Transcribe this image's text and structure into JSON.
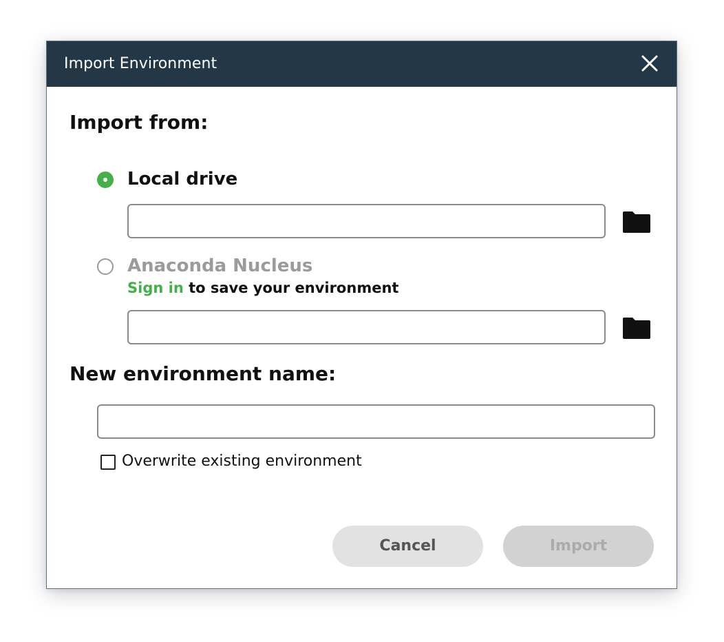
{
  "dialog": {
    "title": "Import Environment",
    "close_icon": "close-icon"
  },
  "import_from": {
    "label": "Import from:",
    "options": [
      {
        "label": "Local drive",
        "selected": true,
        "path_value": "",
        "browse_icon": "folder-icon"
      },
      {
        "label": "Anaconda Nucleus",
        "selected": false,
        "sign_in_link": "Sign in",
        "sign_in_suffix": " to save your environment",
        "path_value": "",
        "browse_icon": "folder-icon"
      }
    ]
  },
  "new_env": {
    "label": "New environment name:",
    "value": "",
    "overwrite_label": "Overwrite existing environment",
    "overwrite_checked": false
  },
  "buttons": {
    "cancel": "Cancel",
    "import": "Import"
  },
  "colors": {
    "titlebar": "#243746",
    "accent_green": "#43b049",
    "disabled_text": "#9b9b9b",
    "cancel_bg": "#e2e2e2",
    "import_disabled_bg": "#d2d2d2"
  }
}
